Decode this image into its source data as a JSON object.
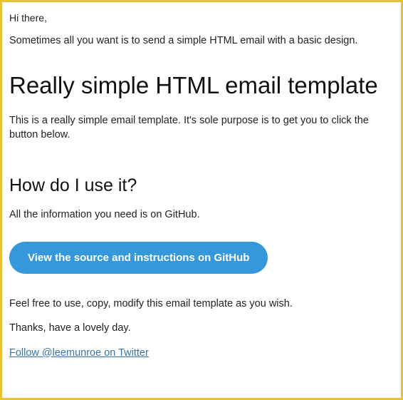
{
  "greeting": "Hi there,",
  "intro": "Sometimes all you want is to send a simple HTML email with a basic design.",
  "main_heading": "Really simple HTML email template",
  "desc": "This is a really simple email template. It's sole purpose is to get you to click the button below.",
  "sub_heading": "How do I use it?",
  "info_text": "All the information you need is on GitHub.",
  "cta_label": "View the source and instructions on GitHub",
  "permission": "Feel free to use, copy, modify this email template as you wish.",
  "signoff": "Thanks, have a lovely day.",
  "follow_link": "Follow @leemunroe on Twitter"
}
